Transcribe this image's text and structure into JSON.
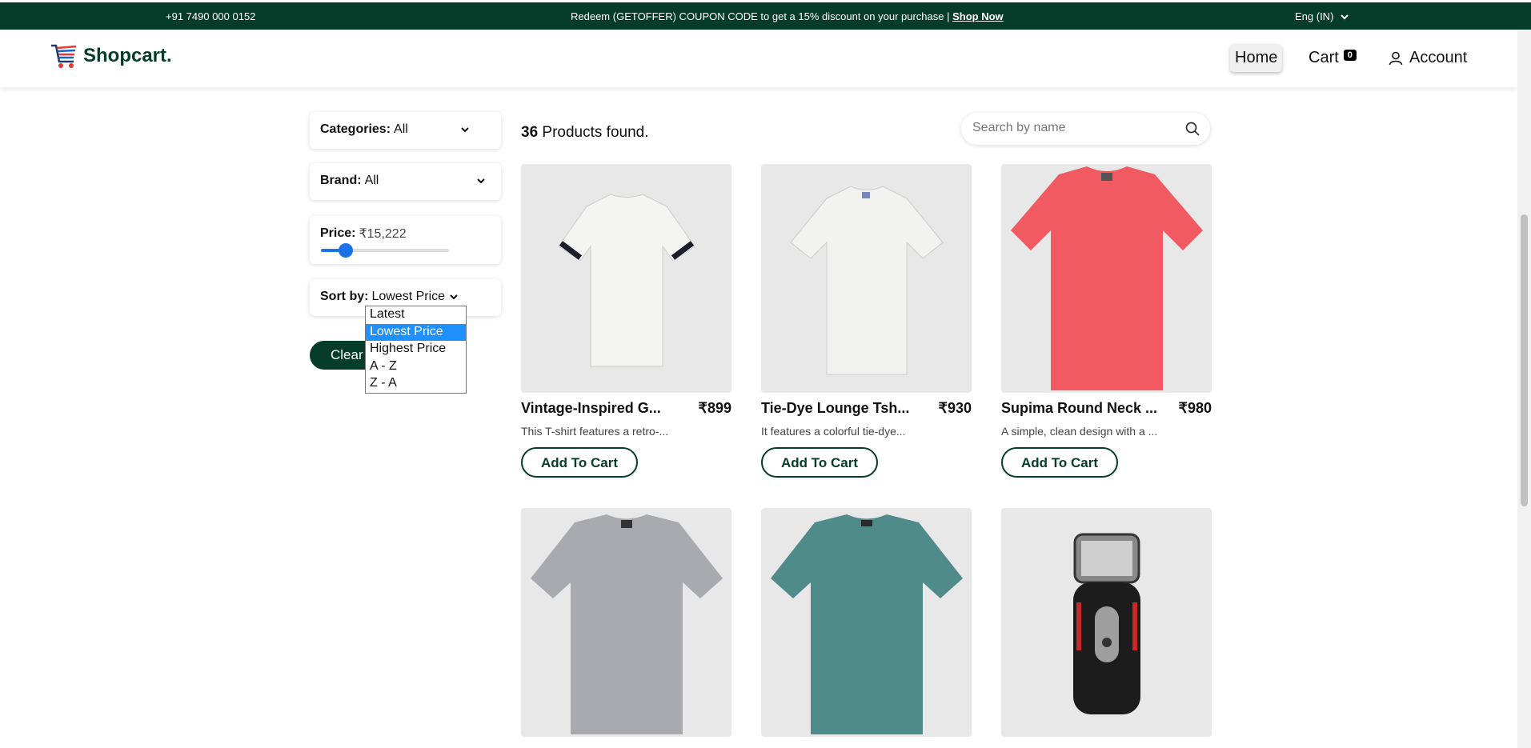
{
  "topbar": {
    "phone": "+91 7490 000 0152",
    "promo_text": "Redeem (GETOFFER) COUPON CODE to get a 15% discount on your purchase  |  ",
    "promo_link": "Shop Now",
    "language": "Eng (IN)"
  },
  "header": {
    "logo": "Shopcart.",
    "nav": {
      "home": "Home",
      "cart": "Cart",
      "cart_count": "0",
      "account": "Account"
    }
  },
  "filters": {
    "categories": {
      "label": "Categories:",
      "value": "All"
    },
    "brand": {
      "label": "Brand:",
      "value": "All"
    },
    "price": {
      "label": "Price:",
      "value": "₹15,222",
      "slider_fraction": 0.16
    },
    "sort": {
      "label": "Sort by:",
      "value": "Lowest Price",
      "options": [
        "Latest",
        "Lowest Price",
        "Highest Price",
        "A - Z",
        "Z - A"
      ],
      "selected_index": 1
    },
    "clear_label": "Clear"
  },
  "results": {
    "count": "36",
    "count_text": "Products found."
  },
  "search": {
    "placeholder": "Search by name"
  },
  "products": [
    {
      "title": "Vintage-Inspired G...",
      "price": "₹899",
      "desc": "This T-shirt features a retro-...",
      "button": "Add To Cart",
      "image": "white-tshirt-back",
      "color": "#f4f4f2"
    },
    {
      "title": "Tie-Dye Lounge Tsh...",
      "price": "₹930",
      "desc": "It features a colorful tie-dye...",
      "button": "Add To Cart",
      "image": "white-tshirt",
      "color": "#f2f2f0"
    },
    {
      "title": "Supima Round Neck ...",
      "price": "₹980",
      "desc": "A simple, clean design with a ...",
      "button": "Add To Cart",
      "image": "red-tshirt",
      "color": "#f25a62"
    },
    {
      "image": "grey-tshirt",
      "color": "#a9aab0"
    },
    {
      "image": "teal-tshirt",
      "color": "#4f8b8b"
    },
    {
      "image": "electric-shaver",
      "color": "#1c1c1c"
    }
  ]
}
